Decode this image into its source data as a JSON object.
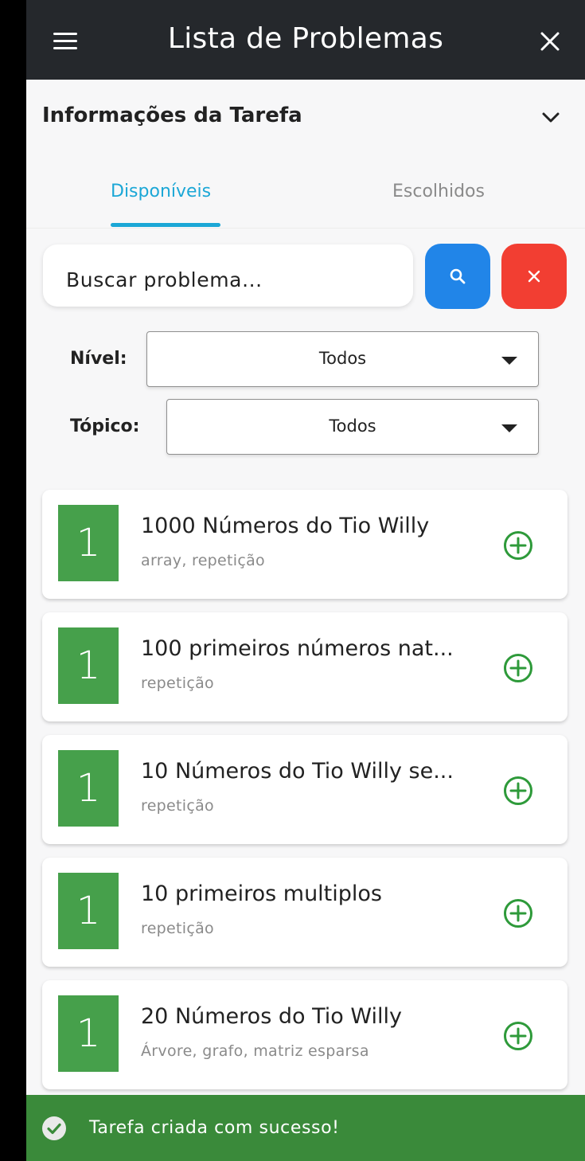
{
  "header": {
    "title": "Lista de Problemas"
  },
  "task_info": {
    "title": "Informações da Tarefa"
  },
  "tabs": [
    {
      "label": "Disponíveis",
      "active": true
    },
    {
      "label": "Escolhidos",
      "active": false
    }
  ],
  "search": {
    "placeholder": "Buscar problema..."
  },
  "filters": {
    "level": {
      "label": "Nível:",
      "value": "Todos"
    },
    "topic": {
      "label": "Tópico:",
      "value": "Todos"
    }
  },
  "problems": [
    {
      "level": "1",
      "title": "1000 Números do Tio Willy",
      "tags": "array, repetição"
    },
    {
      "level": "1",
      "title": "100 primeiros números nat...",
      "tags": "repetição"
    },
    {
      "level": "1",
      "title": "10 Números do Tio Willy se...",
      "tags": "repetição"
    },
    {
      "level": "1",
      "title": "10 primeiros multiplos",
      "tags": "repetição"
    },
    {
      "level": "1",
      "title": "20 Números do Tio Willy",
      "tags": "Árvore, grafo, matriz esparsa"
    }
  ],
  "snackbar": {
    "message": "Tarefa criada com sucesso!"
  },
  "colors": {
    "header_bg": "#25282c",
    "tab_active": "#1ba7d6",
    "search_button": "#2185e8",
    "clear_button": "#f23e32",
    "level_badge": "#46a04b",
    "add_icon": "#2e9a3a",
    "snackbar_bg": "#3a8a3a"
  },
  "icons": {
    "menu": "menu-icon",
    "close": "close-icon",
    "expand": "chevron-down-icon",
    "search": "search-icon",
    "clear": "close-icon",
    "add": "add-circle-icon",
    "success": "check-circle-icon"
  }
}
